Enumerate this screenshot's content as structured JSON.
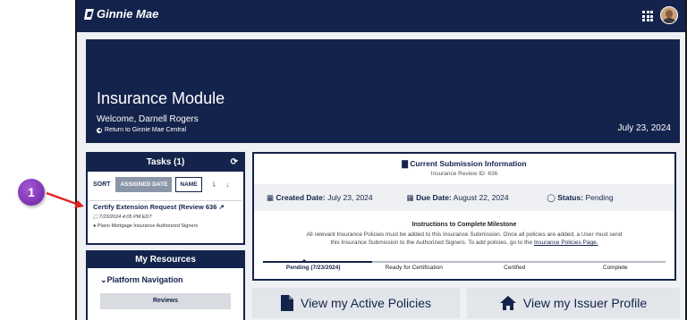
{
  "header": {
    "logo_text": "Ginnie Mae"
  },
  "hero": {
    "title": "Insurance Module",
    "welcome": "Welcome, Darnell Rogers",
    "return_link": "Return to Ginnie Mae Central",
    "date": "July 23, 2024"
  },
  "tasks": {
    "title": "Tasks (1)",
    "sort_label": "SORT",
    "sort_assigned": "ASSIGNED DATE",
    "sort_name": "NAME",
    "item_title": "Certify Extension Request (Review 636",
    "item_date": "7/23/2024 4:05 PM EDT",
    "item_org": "Plano Mortgage Insurance Authorized Signers"
  },
  "resources": {
    "title": "My Resources",
    "nav": "Platform Navigation",
    "reviews_btn": "Reviews"
  },
  "submission": {
    "title": "Current Submission Information",
    "review_id": "Insurance Review ID: 636",
    "created_label": "Created Date:",
    "created_value": "July 23, 2024",
    "due_label": "Due Date:",
    "due_value": "August 22, 2024",
    "status_label": "Status:",
    "status_value": "Pending",
    "instr_title": "Instructions to Complete Milestone",
    "instr_line1": "All relevant Insurance Policies must be added to this Insurance Submission. Once all policies are added, a User must send",
    "instr_line2": "this Insurance Submission to the Authorized Signers. To add policies, go to the",
    "instr_link": "Insurance Policies Page.",
    "steps": [
      "Pending (7/23/2024)",
      "Ready for Certification",
      "Certified",
      "Complete"
    ],
    "progress": 0.27
  },
  "actions": {
    "active_policies": "View my Active Policies",
    "issuer_profile": "View my Issuer Profile"
  },
  "callout": {
    "number": "1"
  }
}
